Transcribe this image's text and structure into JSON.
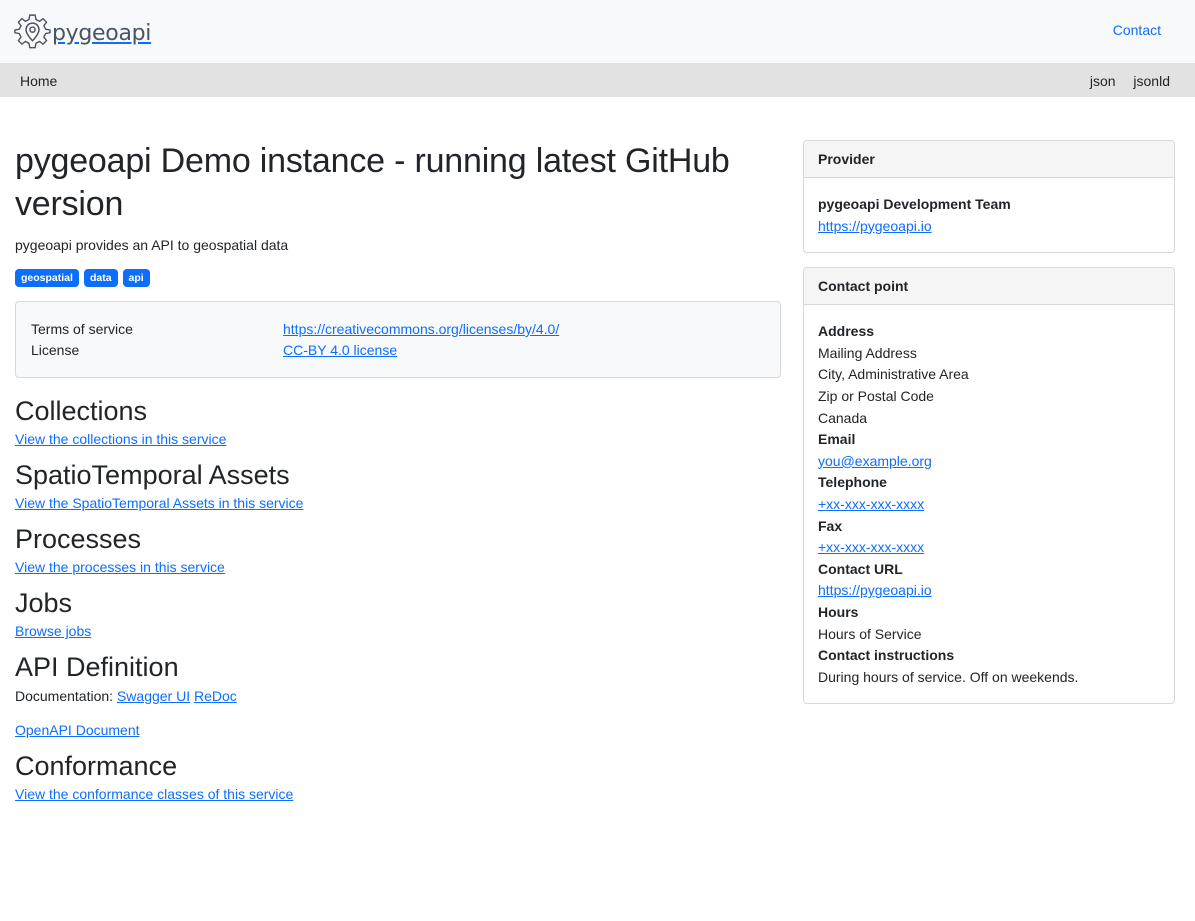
{
  "header": {
    "logo_text": "pygeoapi",
    "contact_label": "Contact"
  },
  "nav": {
    "home_label": "Home",
    "formats": [
      "json",
      "jsonld"
    ]
  },
  "main": {
    "title": "pygeoapi Demo instance - running latest GitHub version",
    "description": "pygeoapi provides an API to geospatial data",
    "keywords": [
      "geospatial",
      "data",
      "api"
    ],
    "terms": {
      "tos_label": "Terms of service",
      "tos_url": "https://creativecommons.org/licenses/by/4.0/",
      "license_label": "License",
      "license_text": "CC-BY 4.0 license"
    },
    "sections": {
      "collections": {
        "heading": "Collections",
        "link": "View the collections in this service"
      },
      "stac": {
        "heading": "SpatioTemporal Assets",
        "link": "View the SpatioTemporal Assets in this service"
      },
      "processes": {
        "heading": "Processes",
        "link": "View the processes in this service"
      },
      "jobs": {
        "heading": "Jobs",
        "link": "Browse jobs"
      },
      "api": {
        "heading": "API Definition",
        "doc_label": "Documentation:",
        "swagger": "Swagger UI",
        "redoc": "ReDoc",
        "openapi": "OpenAPI Document"
      },
      "conformance": {
        "heading": "Conformance",
        "link": "View the conformance classes of this service"
      }
    }
  },
  "provider": {
    "header": "Provider",
    "name": "pygeoapi Development Team",
    "url": "https://pygeoapi.io"
  },
  "contact_point": {
    "header": "Contact point",
    "address_label": "Address",
    "address_lines": [
      "Mailing Address",
      "City, Administrative Area",
      "Zip or Postal Code",
      "Canada"
    ],
    "email_label": "Email",
    "email": "you@example.org",
    "telephone_label": "Telephone",
    "telephone": "+xx-xxx-xxx-xxxx",
    "fax_label": "Fax",
    "fax": "+xx-xxx-xxx-xxxx",
    "contact_url_label": "Contact URL",
    "contact_url": "https://pygeoapi.io",
    "hours_label": "Hours",
    "hours": "Hours of Service",
    "instructions_label": "Contact instructions",
    "instructions": "During hours of service. Off on weekends."
  },
  "colors": {
    "accent": "#0d6efd",
    "topbar_bg": "#f8f9fa",
    "navbar_bg": "#e2e2e2"
  }
}
